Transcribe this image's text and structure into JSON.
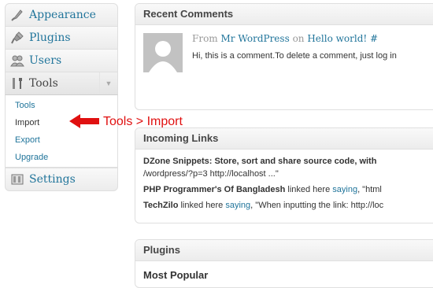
{
  "sidebar": {
    "items": [
      {
        "label": "Appearance",
        "icon": "appearance-icon"
      },
      {
        "label": "Plugins",
        "icon": "plugins-icon"
      },
      {
        "label": "Users",
        "icon": "users-icon"
      },
      {
        "label": "Tools",
        "icon": "tools-icon"
      }
    ],
    "tools_submenu": [
      "Tools",
      "Import",
      "Export",
      "Upgrade"
    ],
    "settings": {
      "label": "Settings",
      "icon": "settings-icon"
    },
    "toggle_icon": "triangle-down-icon"
  },
  "annotation": {
    "text": "Tools > Import",
    "color": "#e01010"
  },
  "recent_comments": {
    "title": "Recent Comments",
    "from": "From",
    "author": "Mr WordPress",
    "on": "on",
    "post": "Hello world!",
    "hash": "#",
    "excerpt": "Hi, this is a comment.To delete a comment, just log in"
  },
  "incoming_links": {
    "title": "Incoming Links",
    "entry1": {
      "title": "DZone Snippets: Store, sort and share source code, with",
      "line2": "/wordpress/?p=3 http://localhost ...\""
    },
    "entry2": {
      "name": "PHP Programmer's Of Bangladesh",
      "linked": "linked here",
      "saying": "saying",
      "tail": ", \"html"
    },
    "entry3": {
      "name": "TechZilo",
      "linked": "linked here",
      "saying": "saying",
      "tail": ", \"When inputting the link: http://loc"
    }
  },
  "plugins": {
    "title": "Plugins",
    "most_popular": "Most Popular"
  },
  "colors": {
    "link": "#21759b",
    "header_text": "#464646"
  }
}
